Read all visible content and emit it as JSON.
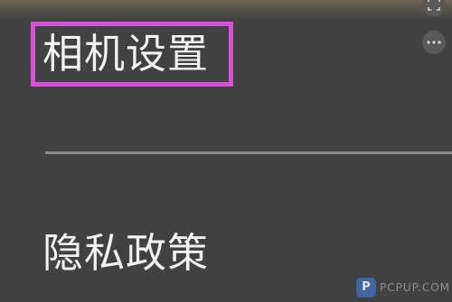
{
  "menu": {
    "camera_settings": "相机设置",
    "privacy_policy": "隐私政策"
  },
  "top_buttons": {
    "scan_icon": "scan-icon",
    "more_icon": "more-icon"
  },
  "watermark": {
    "logo_letter": "P",
    "text": "PCPUP.COM"
  },
  "colors": {
    "background": "#414141",
    "highlight": "#d84fd8",
    "divider": "#888888",
    "text": "#f2f2f2"
  }
}
